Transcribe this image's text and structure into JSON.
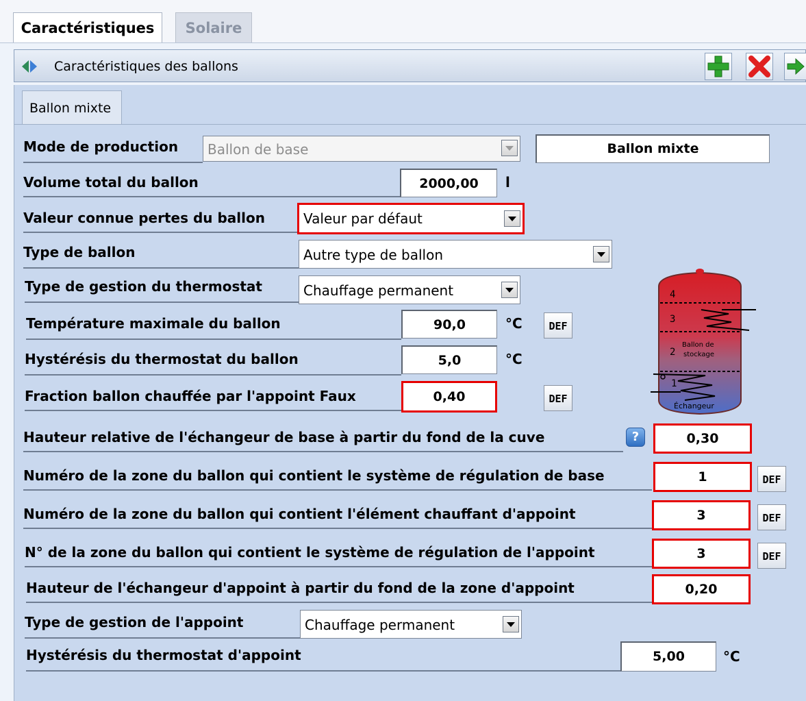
{
  "tabs": [
    "Caractéristiques",
    "Solaire"
  ],
  "header": {
    "title": "Caractéristiques des ballons"
  },
  "subtab": "Ballon mixte",
  "def_label": "DEF",
  "info_icon_label": "?",
  "diagram": {
    "zones": [
      "4",
      "3",
      "2",
      "1"
    ],
    "storage_label_1": "Ballon de",
    "storage_label_2": "stockage",
    "exchanger_label": "Échangeur"
  },
  "form": {
    "mode": {
      "label": "Mode de production",
      "value": "Ballon de base",
      "name_value": "Ballon mixte"
    },
    "volume": {
      "label": "Volume total du ballon",
      "value": "2000,00",
      "unit": "l"
    },
    "pertes": {
      "label": "Valeur connue pertes du ballon",
      "value": "Valeur par défaut"
    },
    "type_ballon": {
      "label": "Type de ballon",
      "value": "Autre type de ballon"
    },
    "thermostat": {
      "label": "Type de gestion du thermostat",
      "value": "Chauffage permanent"
    },
    "temp_max": {
      "label": "Température maximale du ballon",
      "value": "90,0",
      "unit": "°C"
    },
    "hysteresis": {
      "label": "Hystérésis du thermostat du ballon",
      "value": "5,0",
      "unit": "°C"
    },
    "fraction": {
      "label": "Fraction ballon chauffée par l'appoint Faux",
      "value": "0,40"
    },
    "hauteur_echangeur": {
      "label": "Hauteur relative de l'échangeur de base à partir du fond de la cuve",
      "value": "0,30"
    },
    "zone_regulation_base": {
      "label": "Numéro de la zone du ballon qui contient le système de régulation de base",
      "value": "1"
    },
    "zone_element_appoint": {
      "label": "Numéro de la zone du ballon qui contient l'élément chauffant d'appoint",
      "value": "3"
    },
    "zone_regulation_appoint": {
      "label": "N° de la zone du ballon qui contient le système de régulation de l'appoint",
      "value": "3"
    },
    "hauteur_appoint": {
      "label": "Hauteur de l'échangeur d'appoint à partir du fond de la zone d'appoint",
      "value": "0,20"
    },
    "gestion_appoint": {
      "label": "Type de gestion de l'appoint",
      "value": "Chauffage permanent"
    },
    "hysteresis_appoint": {
      "label": "Hystérésis du thermostat d'appoint",
      "value": "5,00",
      "unit": "°C"
    }
  }
}
